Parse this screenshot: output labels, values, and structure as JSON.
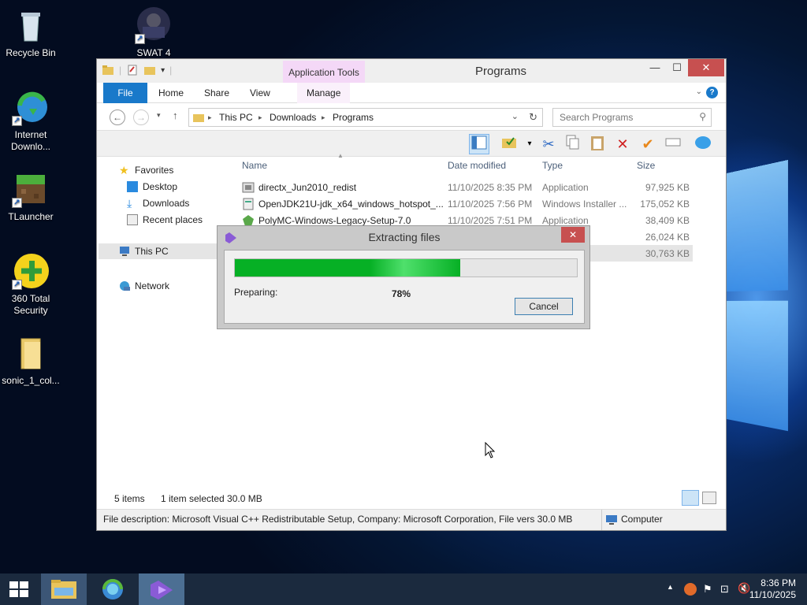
{
  "desktop": {
    "icons": [
      {
        "label": "Recycle Bin",
        "icon": "recycle-bin-icon"
      },
      {
        "label": "SWAT 4",
        "icon": "swat4-icon"
      },
      {
        "label": "Internet Downlo...",
        "icon": "internet-download-manager-icon"
      },
      {
        "label": "TLauncher",
        "icon": "tlauncher-icon"
      },
      {
        "label": "360 Total Security",
        "icon": "360-total-security-icon"
      },
      {
        "label": "sonic_1_col...",
        "icon": "folder-icon"
      }
    ]
  },
  "explorer": {
    "title": "Programs",
    "context_tab": "Application Tools",
    "ribbon_tabs": [
      "File",
      "Home",
      "Share",
      "View",
      "Manage"
    ],
    "breadcrumb": [
      "This PC",
      "Downloads",
      "Programs"
    ],
    "search_placeholder": "Search Programs",
    "nav": {
      "favorites": "Favorites",
      "desktop": "Desktop",
      "downloads": "Downloads",
      "recent": "Recent places",
      "this_pc": "This PC",
      "network": "Network"
    },
    "columns": [
      "Name",
      "Date modified",
      "Type",
      "Size"
    ],
    "files": [
      {
        "name": "directx_Jun2010_redist",
        "date": "11/10/2025 8:35 PM",
        "type": "Application",
        "size": "97,925 KB"
      },
      {
        "name": "OpenJDK21U-jdk_x64_windows_hotspot_...",
        "date": "11/10/2025 7:56 PM",
        "type": "Windows Installer ...",
        "size": "175,052 KB"
      },
      {
        "name": "PolyMC-Windows-Legacy-Setup-7.0",
        "date": "11/10/2025 7:51 PM",
        "type": "Application",
        "size": "38,409 KB"
      },
      {
        "name": "",
        "date": "",
        "type": "",
        "size": "26,024 KB"
      },
      {
        "name": "",
        "date": "",
        "type": "",
        "size": "30,763 KB"
      }
    ],
    "status": {
      "items": "5 items",
      "selected": "1 item selected  30.0 MB"
    },
    "infobar": {
      "description": "File description: Microsoft Visual C++ Redistributable Setup, Company: Microsoft Corporation, File vers 30.0 MB",
      "location": "Computer"
    }
  },
  "dialog": {
    "title": "Extracting files",
    "close_label": "✕",
    "status_label": "Preparing:",
    "percent_label": "78%",
    "progress_fraction": 0.66,
    "cancel_label": "Cancel"
  },
  "taskbar": {
    "time": "8:36 PM",
    "date": "11/10/2025"
  },
  "colors": {
    "accent": "#1979ca",
    "progress": "#06b025",
    "close_red": "#c75050",
    "context_tab": "#f4d8f7"
  }
}
